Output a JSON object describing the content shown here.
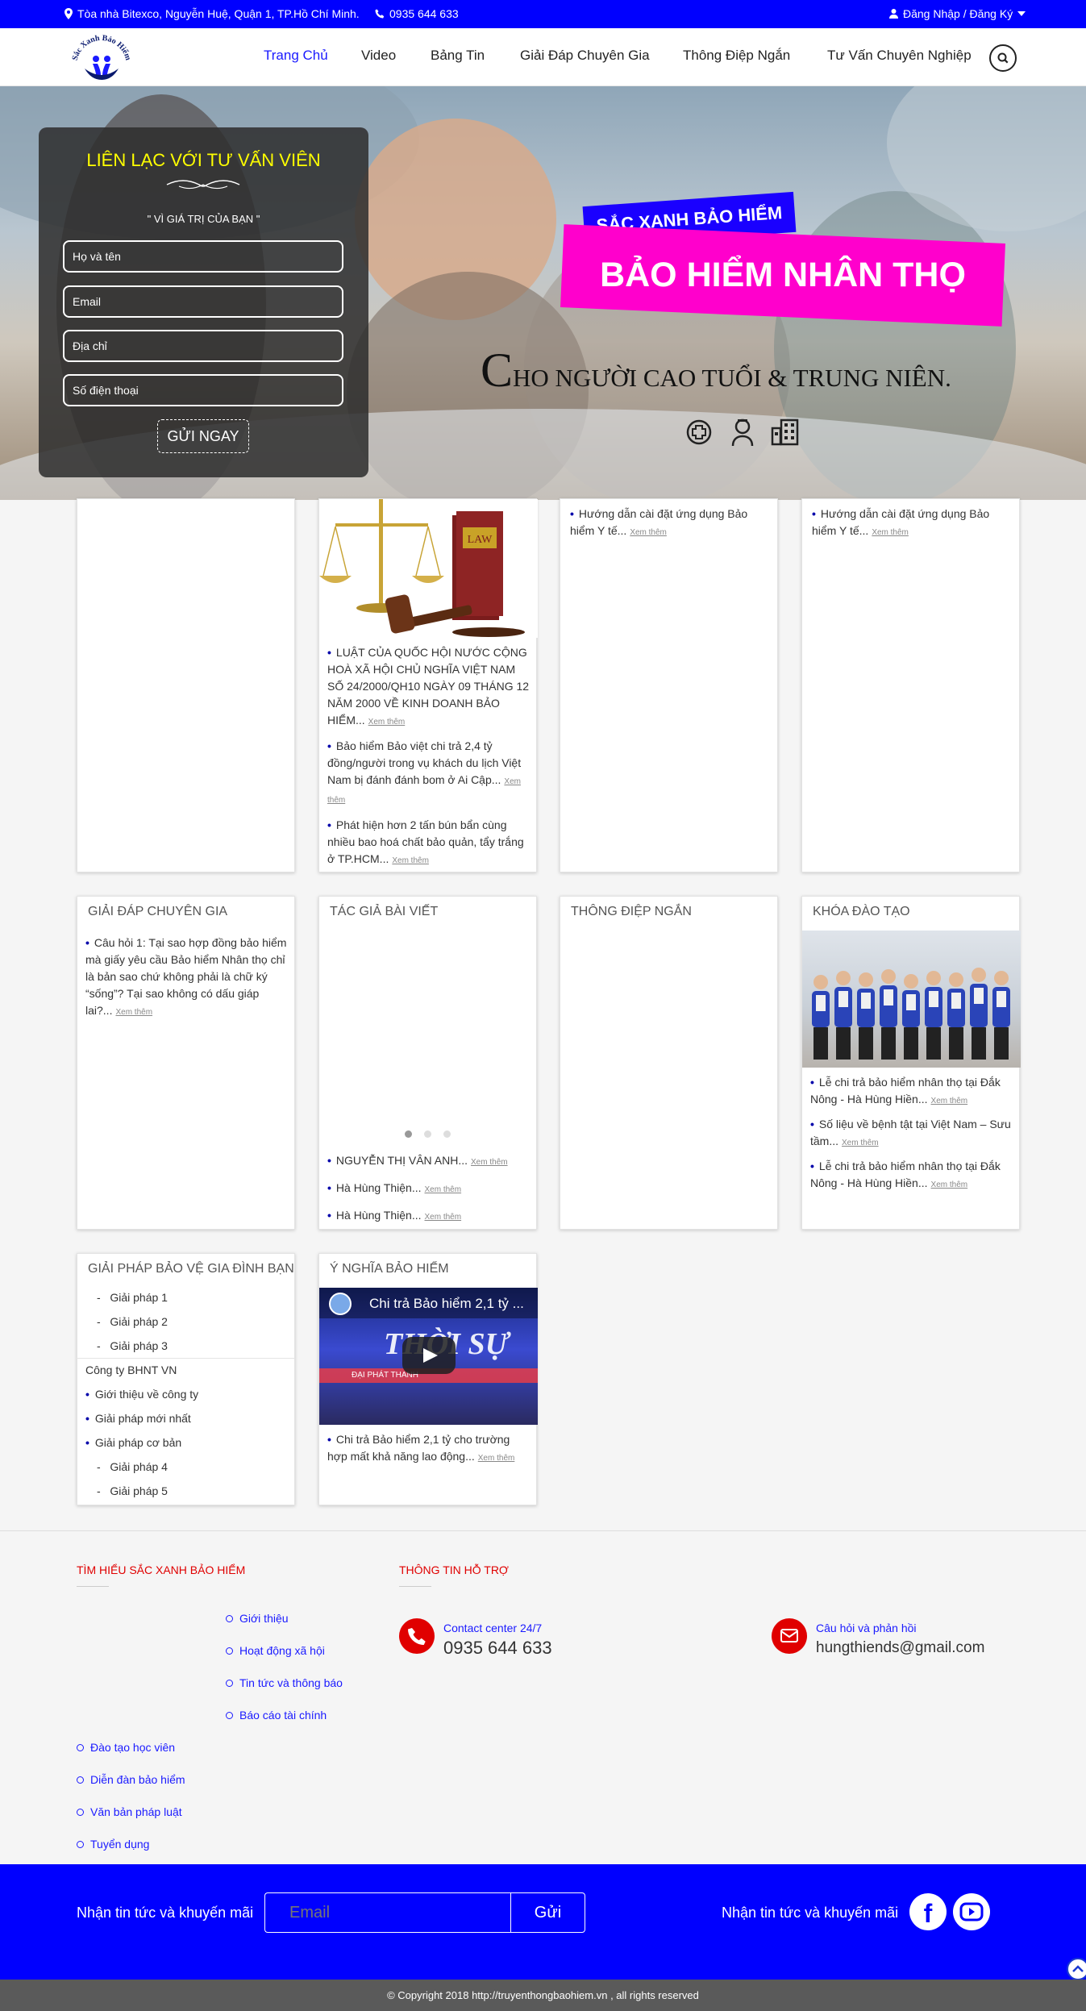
{
  "colors": {
    "brand_blue": "#0000ff",
    "magenta": "#ff00cc",
    "form_title_yellow": "#ffff00",
    "footer_red": "#e00000"
  },
  "topbar": {
    "address": "Tòa nhà Bitexco, Nguyễn Huệ, Quận 1, TP.Hồ Chí Minh.",
    "phone": "0935 644 633",
    "login": "Đăng Nhập / Đăng Ký"
  },
  "logo": {
    "text": "Sắc Xanh Bảo Hiểm"
  },
  "nav": {
    "items": [
      "Trang Chủ",
      "Video",
      "Bảng Tin",
      "Giải Đáp Chuyên Gia",
      "Thông Điệp Ngắn",
      "Tư Vấn Chuyên Nghiệp"
    ]
  },
  "hero": {
    "form": {
      "title": "LIÊN LẠC VỚI TƯ VẤN VIÊN",
      "tagline": "\" VÌ GIÁ TRỊ CỦA BẠN \"",
      "name_placeholder": "Họ và tên",
      "email_placeholder": "Email",
      "address_placeholder": "Địa chỉ",
      "phone_placeholder": "Số điện thoại",
      "submit": "GỬI NGAY"
    },
    "brand_tag": "SẮC XANH BẢO HIỂM",
    "headline": "BẢO HIỂM NHÂN THỌ",
    "sub_first": "C",
    "sub_rest": "HO NGƯỜI CAO TUỔI & TRUNG NIÊN."
  },
  "more": "Xem thêm",
  "row1": {
    "card2": {
      "items": [
        "LUẬT CỦA QUỐC HỘI NƯỚC CỘNG HOÀ XÃ HỘI CHỦ NGHĨA VIỆT NAM SỐ 24/2000/QH10 NGÀY 09 THÁNG 12 NĂM 2000 VỀ KINH DOANH BẢO HIỂM...",
        "Bảo hiểm Bảo việt chi trả 2,4 tỷ đồng/người trong vụ khách du lịch Việt Nam bị đánh đánh bom ở Ai Cập...",
        "Phát hiện hơn 2 tấn bún bẩn cùng nhiều bao hoá chất bảo quản, tẩy trắng ở TP.HCM..."
      ],
      "book_label": "LAW"
    },
    "card3": {
      "item": "Hướng dẫn cài đặt ứng dụng Bảo hiểm Y tế..."
    },
    "card4": {
      "item": "Hướng dẫn cài đặt ứng dụng Bảo hiểm Y tế..."
    }
  },
  "row2": {
    "expert": {
      "title": "GIẢI ĐÁP CHUYÊN GIA",
      "item": "Câu hỏi 1: Tại sao hợp đồng bảo hiểm mà giấy yêu cầu Bảo hiểm Nhân thọ chỉ là bản sao chứ không phải là chữ ký “sống”? Tại sao không có dấu giáp lai?..."
    },
    "authors": {
      "title": "TÁC GIẢ BÀI VIẾT",
      "items": [
        "NGUYỄN THỊ VÂN ANH...",
        "Hà Hùng Thiện...",
        "Hà Hùng Thiện..."
      ]
    },
    "short": {
      "title": "THÔNG ĐIỆP NGẮN"
    },
    "training": {
      "title": "KHÓA ĐÀO TẠO",
      "items": [
        "Lễ chi trả bảo hiểm nhân thọ tại Đắk Nông - Hà Hùng Hiền...",
        "Số liệu về bệnh tật tại Việt Nam – Sưu tầm...",
        "Lễ chi trả bảo hiểm nhân thọ tại Đắk Nông - Hà Hùng Hiền..."
      ]
    }
  },
  "row3": {
    "solutions": {
      "title": "GIẢI PHÁP BẢO VỆ GIA ĐÌNH BẠN",
      "sub1": [
        "Giải pháp 1",
        "Giải pháp 2",
        "Giải pháp 3"
      ],
      "company": "Công ty BHNT VN",
      "bullets": [
        "Giới thiệu về công ty",
        "Giải pháp mới nhất",
        "Giải pháp cơ bản"
      ],
      "sub2": [
        "Giải pháp 4",
        "Giải pháp 5"
      ]
    },
    "meaning": {
      "title": "Ý NGHĨA BẢO HIỂM",
      "video_title": "Chi trả Bảo hiểm 2,1 tỷ ...",
      "video_overlay": "THỜI SỰ",
      "video_ticker": "ĐẠI PHÁT THANH",
      "item": "Chi trả Bảo hiểm 2,1 tỷ cho trường hợp mất khả năng lao động..."
    }
  },
  "footer": {
    "about_title": "TÌM HIỂU SẮC XANH BẢO HIỂM",
    "support_title": "THÔNG TIN HỖ TRỢ",
    "links_right": [
      "Giới thiệu",
      "Hoạt động xã hội",
      "Tin tức và thông báo",
      "Báo cáo tài chính"
    ],
    "links_left": [
      "Đào tạo học viên",
      "Diễn đàn bảo hiểm",
      "Văn bản pháp luật",
      "Tuyển dụng"
    ],
    "contact_label": "Contact center 24/7",
    "contact_phone": "0935 644 633",
    "feedback_label": "Câu hỏi và phản hồi",
    "feedback_email": "hungthiends@gmail.com"
  },
  "subscribe": {
    "label": "Nhận tin tức và khuyến mãi",
    "placeholder": "Email",
    "button": "Gửi",
    "social_label": "Nhận tin tức và khuyến mãi",
    "facebook": "f"
  },
  "copyright": "© Copyright 2018 http://truyenthongbaohiem.vn , all rights reserved"
}
